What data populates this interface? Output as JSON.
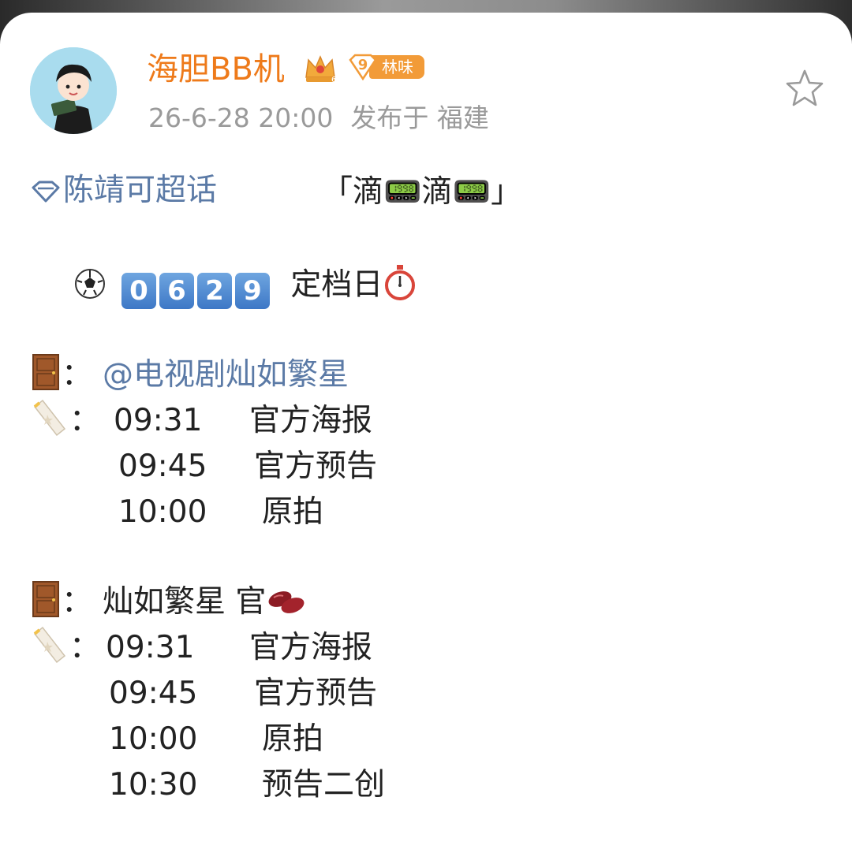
{
  "post": {
    "author": {
      "name": "海胆BB机",
      "level_number": "9",
      "fan_badge": "林味",
      "crown_level": "6"
    },
    "time": "26-6-28 20:00",
    "location": "发布于 福建",
    "topic": "陈靖可超话",
    "headline": "「滴📟滴📟」",
    "countdown_digits": [
      "0",
      "6",
      "2",
      "9"
    ],
    "countdown_label": "定档日",
    "sections": [
      {
        "source_label": "：",
        "source_mention": "@电视剧灿如繁星",
        "schedule": [
          {
            "time": "09:31",
            "item": "官方海报"
          },
          {
            "time": "09:45",
            "item": "官方预告"
          },
          {
            "time": "10:00",
            "item": "原拍"
          }
        ]
      },
      {
        "source_label": "：",
        "source_text": "灿如繁星 官",
        "schedule": [
          {
            "time": "09:31",
            "item": "官方海报"
          },
          {
            "time": "09:45",
            "item": "官方预告"
          },
          {
            "time": "10:00",
            "item": "原拍"
          },
          {
            "time": "10:30",
            "item": "预告二创"
          }
        ]
      }
    ],
    "ticket_label": "："
  },
  "colors": {
    "username": "#ee7a1a",
    "link": "#5b7aa6",
    "meta": "#9a9a9a",
    "badge": "#f29b38",
    "number_box": "#3d78c6"
  },
  "icons": {
    "favorite": "star-outline-icon",
    "topic": "diamond-icon",
    "door": "door-icon",
    "ticket": "ticket-icon",
    "ball": "soccer-ball-icon",
    "timer": "stopwatch-icon",
    "pager": "pager-icon",
    "beans": "beans-icon"
  }
}
